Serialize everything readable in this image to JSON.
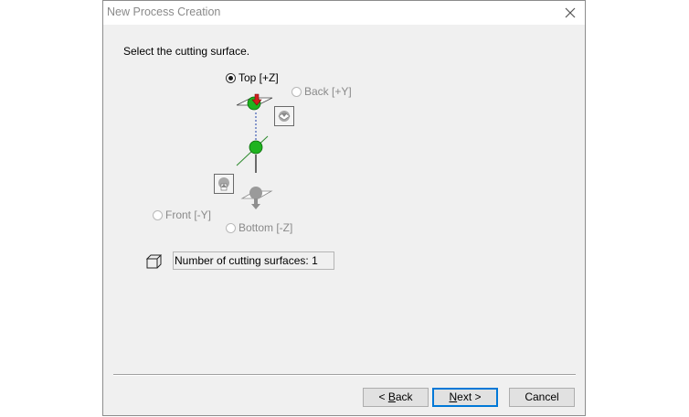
{
  "dialog": {
    "title": "New Process Creation",
    "instruction": "Select the cutting surface."
  },
  "surfaces": {
    "top": {
      "label": "Top [+Z]",
      "checked": true,
      "enabled": true
    },
    "back": {
      "label": "Back [+Y]",
      "checked": false,
      "enabled": false
    },
    "front": {
      "label": "Front [-Y]",
      "checked": false,
      "enabled": false
    },
    "bottom": {
      "label": "Bottom [-Z]",
      "checked": false,
      "enabled": false
    }
  },
  "count": {
    "text": "Number of cutting surfaces: 1"
  },
  "buttons": {
    "back": {
      "prefix": "< ",
      "mnemonic": "B",
      "rest": "ack"
    },
    "next": {
      "mnemonic": "N",
      "rest": "ext >"
    },
    "cancel": {
      "label": "Cancel"
    }
  },
  "colors": {
    "sphere": "#1fb31f",
    "arrow": "#d21e1e",
    "axis_y": "#2e8b2e",
    "default_button_border": "#0078d7"
  },
  "icons": [
    "close-icon",
    "cutting-direction-arrow-icon",
    "workpiece-sphere-icon",
    "back-surface-icon",
    "front-surface-icon",
    "bottom-surface-icon",
    "box-icon"
  ]
}
